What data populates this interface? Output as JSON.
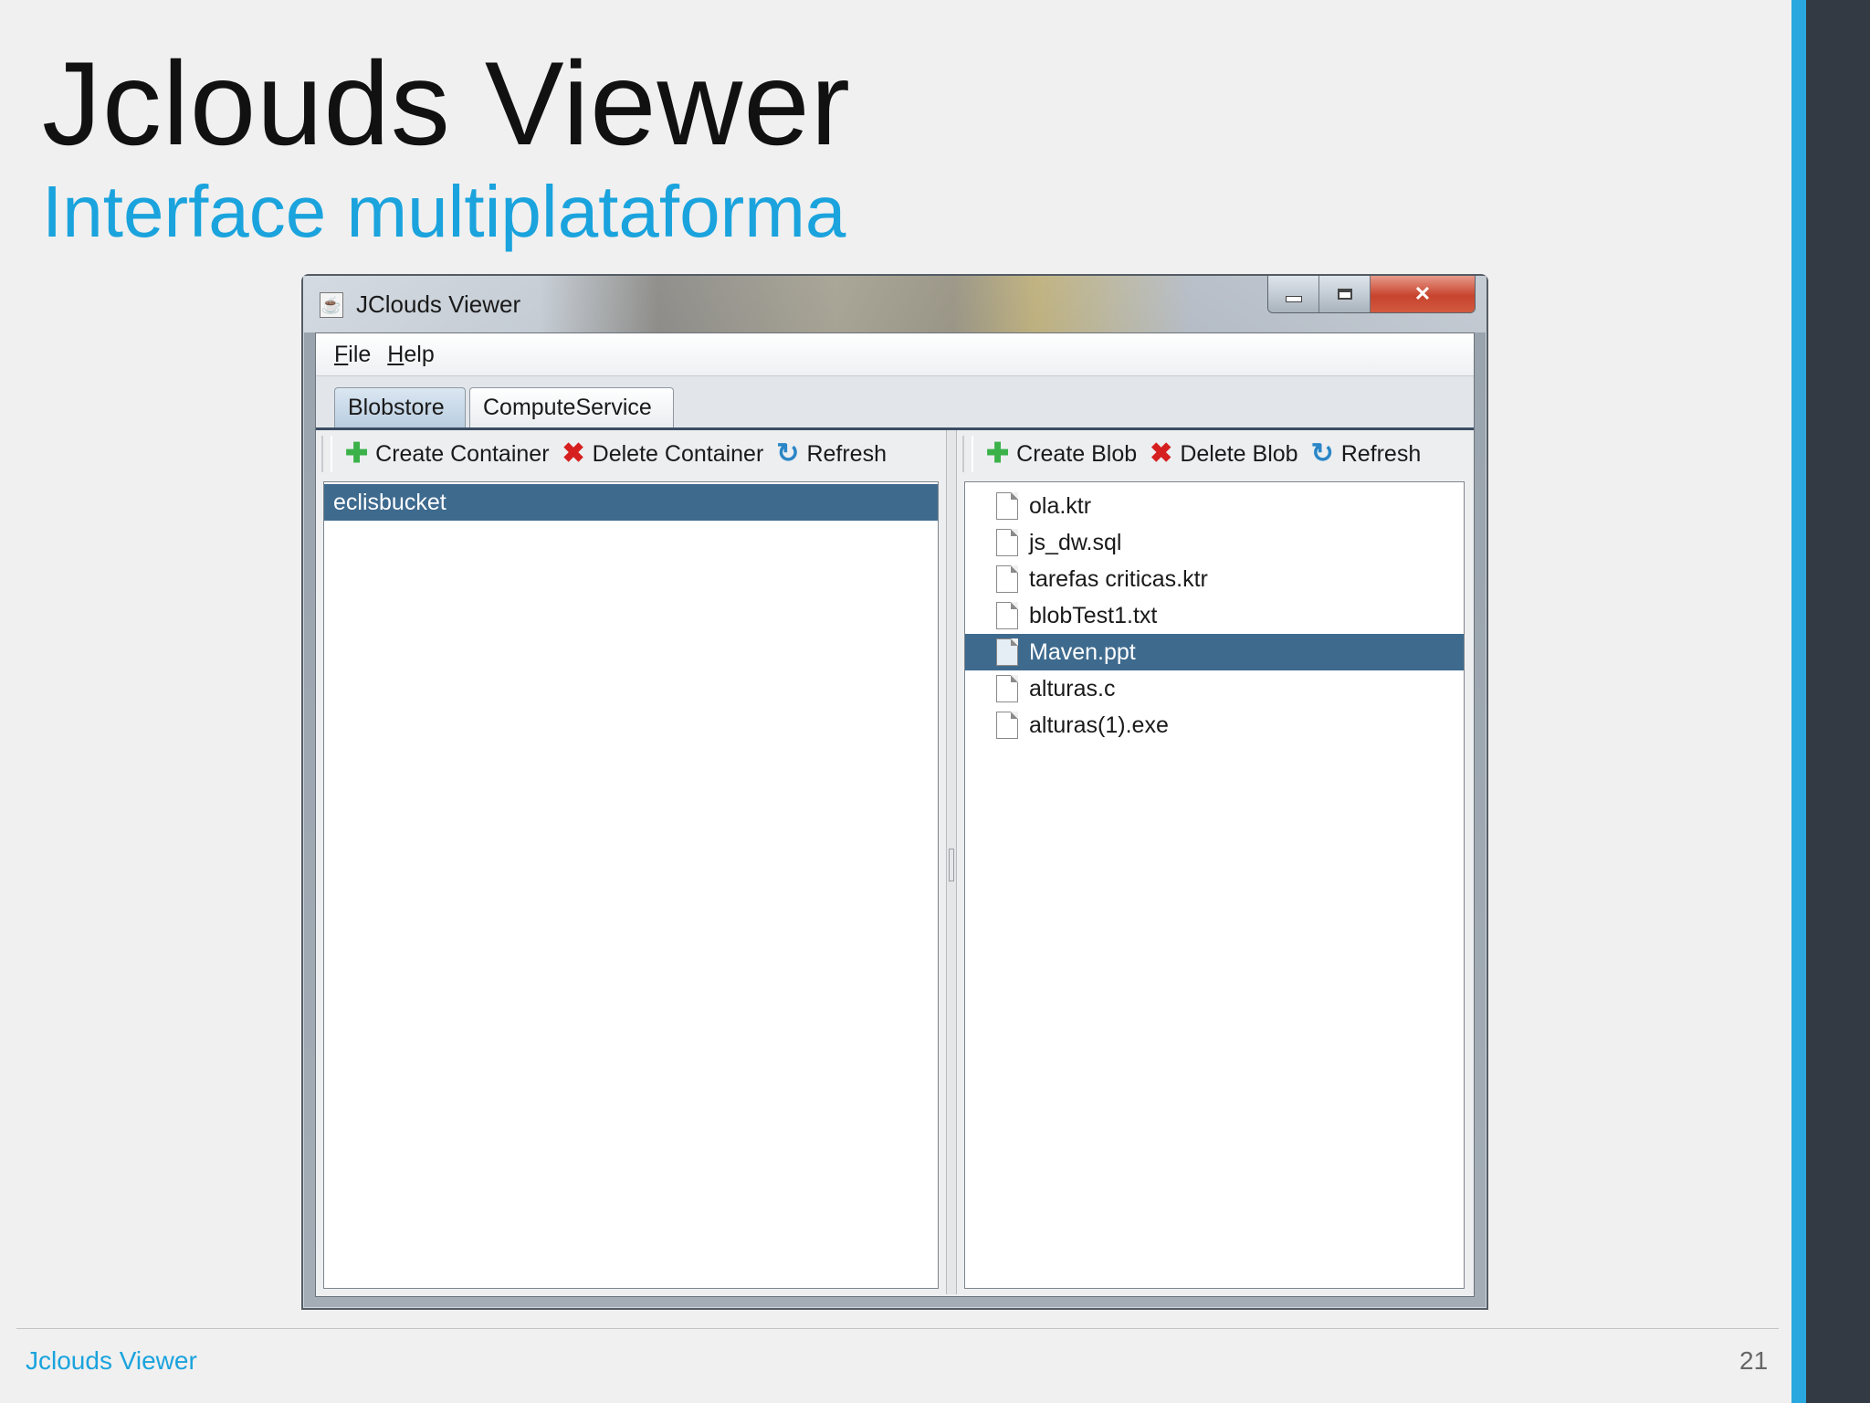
{
  "slide": {
    "title": "Jclouds Viewer",
    "subtitle": "Interface multiplataforma",
    "footer": "Jclouds Viewer",
    "page_number": "21"
  },
  "window": {
    "title": "JClouds Viewer",
    "icon": "java-cup-icon",
    "controls": [
      "minimize-icon",
      "maximize-icon",
      "close-icon"
    ]
  },
  "menu": {
    "items": [
      {
        "mnemonic": "F",
        "rest": "ile"
      },
      {
        "mnemonic": "H",
        "rest": "elp"
      }
    ]
  },
  "tabs": [
    {
      "label": "Blobstore",
      "active": true
    },
    {
      "label": "ComputeService",
      "active": false
    }
  ],
  "containers_toolbar": {
    "create_label": "Create Container",
    "delete_label": "Delete Container",
    "refresh_label": "Refresh"
  },
  "blobs_toolbar": {
    "create_label": "Create Blob",
    "delete_label": "Delete Blob",
    "refresh_label": "Refresh"
  },
  "containers": [
    {
      "name": "eclisbucket",
      "selected": true
    }
  ],
  "blobs": [
    {
      "name": "ola.ktr",
      "selected": false
    },
    {
      "name": "js_dw.sql",
      "selected": false
    },
    {
      "name": "tarefas criticas.ktr",
      "selected": false
    },
    {
      "name": "blobTest1.txt",
      "selected": false
    },
    {
      "name": "Maven.ppt",
      "selected": true
    },
    {
      "name": "alturas.c",
      "selected": false
    },
    {
      "name": "alturas(1).exe",
      "selected": false
    }
  ],
  "colors": {
    "accent": "#1aa3dd",
    "selection": "#3e6a8e",
    "side_dark": "#333a44"
  }
}
